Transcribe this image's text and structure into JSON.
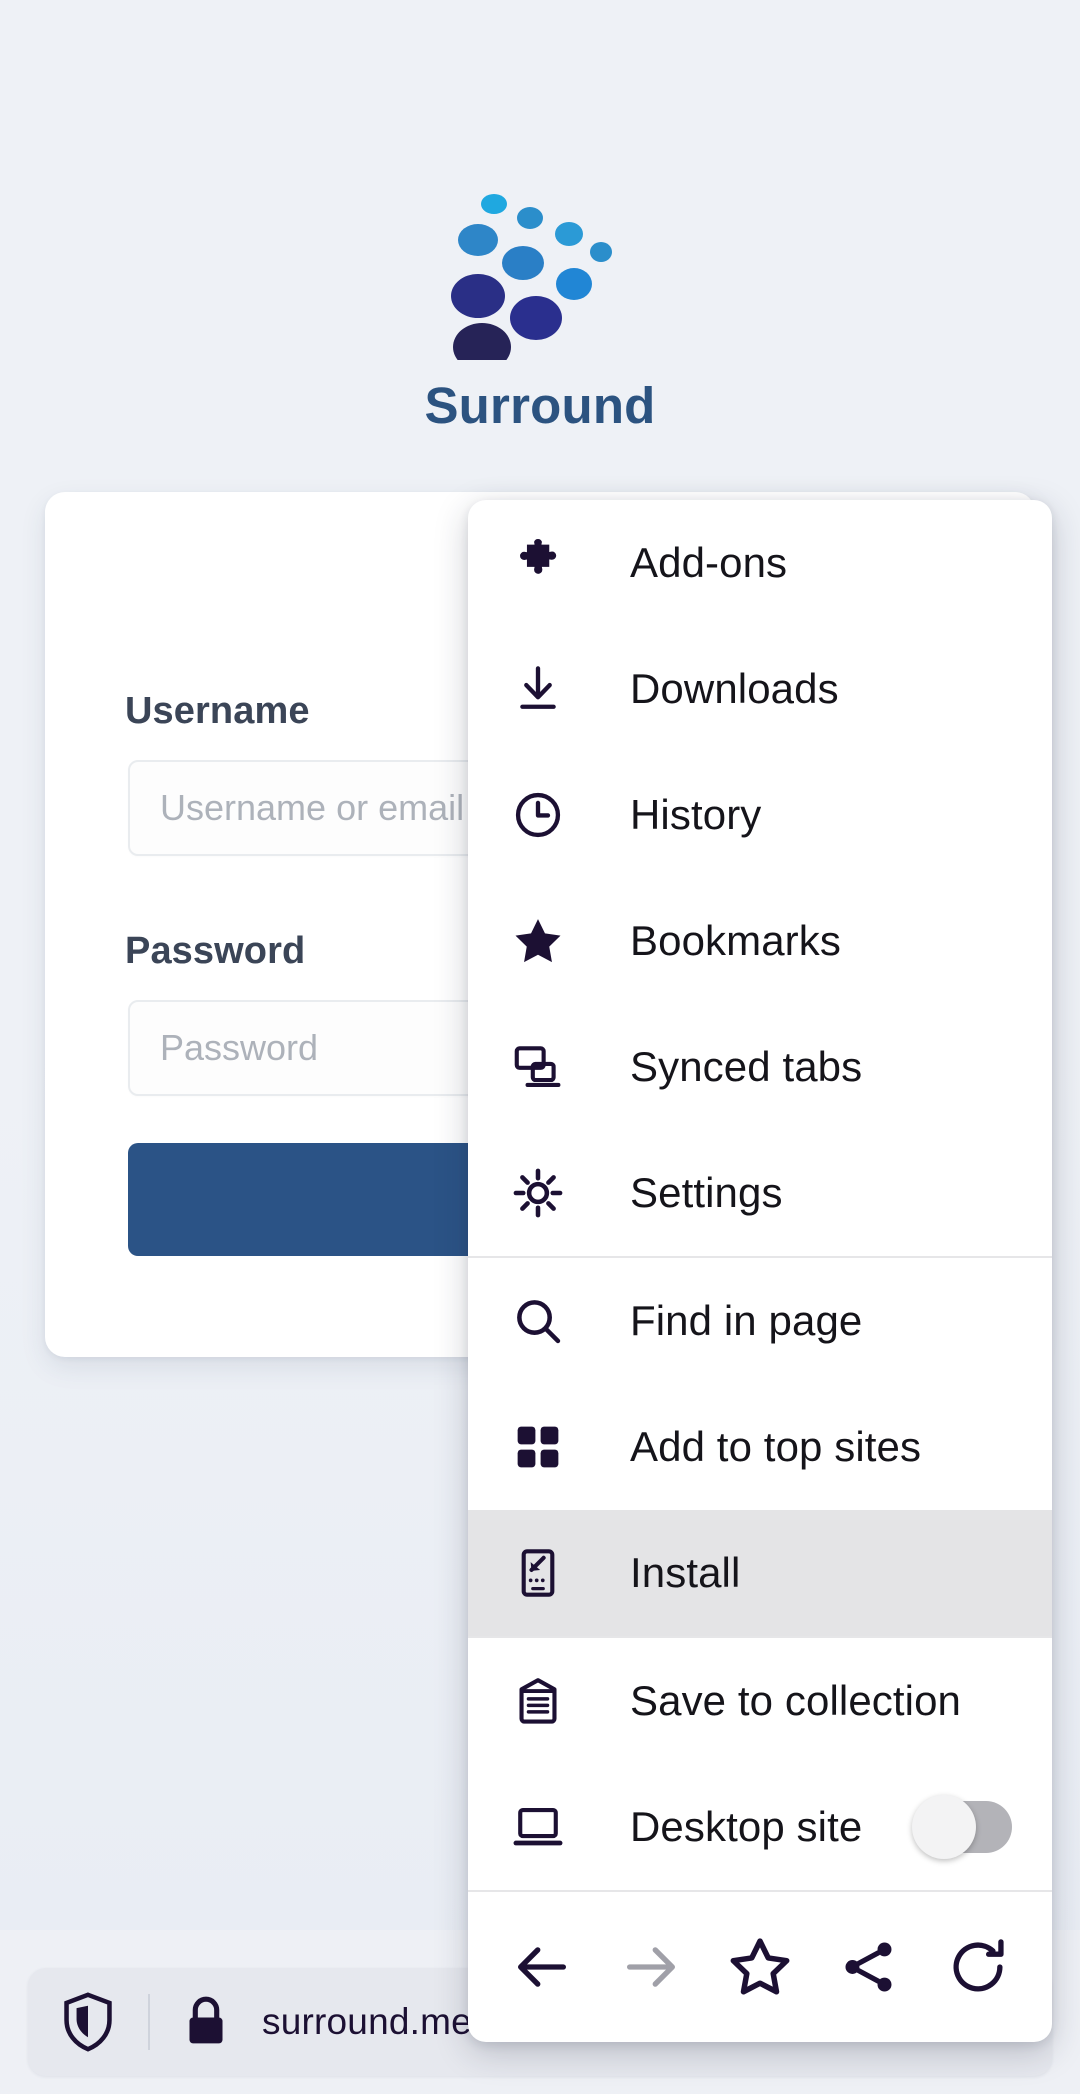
{
  "brand": {
    "name": "Surround",
    "logo_icon": "dots-swirl-logo",
    "logo_colors": [
      "#1fa8e0",
      "#2b8ecb",
      "#2b5fc4",
      "#2a2f86",
      "#262357"
    ]
  },
  "login_form": {
    "username_label": "Username",
    "username_placeholder": "Username or email",
    "password_label": "Password",
    "password_placeholder": "Password",
    "submit_label": "",
    "submit_color": "#2b5386"
  },
  "url_bar": {
    "shield_icon": "shield-icon",
    "lock_icon": "lock-icon",
    "url": "surround.me"
  },
  "menu": {
    "highlight_color": "#e4e4e6",
    "groups": [
      {
        "items": [
          {
            "icon": "puzzle-piece-icon",
            "label": "Add-ons",
            "highlighted": false
          },
          {
            "icon": "download-arrow-icon",
            "label": "Downloads",
            "highlighted": false
          },
          {
            "icon": "clock-icon",
            "label": "History",
            "highlighted": false
          },
          {
            "icon": "star-filled-icon",
            "label": "Bookmarks",
            "highlighted": false
          },
          {
            "icon": "synced-devices-icon",
            "label": "Synced tabs",
            "highlighted": false
          },
          {
            "icon": "gear-icon",
            "label": "Settings",
            "highlighted": false
          }
        ]
      },
      {
        "items": [
          {
            "icon": "search-icon",
            "label": "Find in page",
            "highlighted": false
          },
          {
            "icon": "grid-squares-icon",
            "label": "Add to top sites",
            "highlighted": false
          },
          {
            "icon": "install-phone-icon",
            "label": "Install",
            "highlighted": true
          }
        ]
      },
      {
        "items": [
          {
            "icon": "collection-icon",
            "label": "Save to collection",
            "highlighted": false
          },
          {
            "icon": "laptop-icon",
            "label": "Desktop site",
            "highlighted": false,
            "toggle": "off"
          }
        ]
      }
    ],
    "nav_row": [
      {
        "icon": "arrow-left-icon",
        "name": "back-button",
        "disabled": false
      },
      {
        "icon": "arrow-right-icon",
        "name": "forward-button",
        "disabled": true
      },
      {
        "icon": "star-outline-icon",
        "name": "bookmark-button",
        "disabled": false
      },
      {
        "icon": "share-icon",
        "name": "share-button",
        "disabled": false
      },
      {
        "icon": "reload-icon",
        "name": "reload-button",
        "disabled": false
      }
    ]
  }
}
